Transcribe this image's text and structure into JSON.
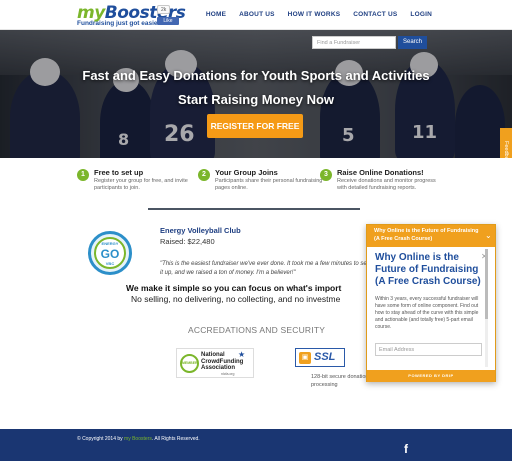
{
  "header": {
    "logo_my": "my",
    "logo_boosters": "Boosters",
    "tagline": "Fundraising just got easier.",
    "fb_count": "2k",
    "fb_like": "Like",
    "nav": [
      "HOME",
      "ABOUT US",
      "HOW IT WORKS",
      "CONTACT US",
      "LOGIN"
    ]
  },
  "hero": {
    "search_placeholder": "Find a Fundraiser",
    "search_button": "Search",
    "title": "Fast and Easy Donations for Youth Sports and Activities",
    "subtitle": "Start Raising Money Now",
    "register_button": "REGISTER FOR FREE",
    "feedback_tab": "Feedback",
    "jersey_numbers": [
      "26",
      "8",
      "5",
      "11"
    ]
  },
  "steps": [
    {
      "num": "1",
      "title": "Free to set up",
      "desc": "Register your group for free, and invite participants to join."
    },
    {
      "num": "2",
      "title": "Your Group Joins",
      "desc": "Participants share their personal fundraising pages online."
    },
    {
      "num": "3",
      "title": "Raise Online Donations!",
      "desc": "Receive donations and monitor progress with detailed fundraising reports."
    }
  ],
  "testimonial": {
    "logo_top": "ENERGY",
    "logo_mid": "GO",
    "logo_bot": "VBC",
    "club_name": "Energy Volleyball Club",
    "raised": "Raised: $22,480",
    "quote": "\"This is the easiest fundraiser we've ever done. It took me a few minutes to set it up, and we raised a ton of money. I'm a believer!\""
  },
  "simple": {
    "heading": "We make it simple so you can focus on what's import",
    "sub": "No selling, no delivering, no collecting, and no investme"
  },
  "accreditations": {
    "heading": "ACCREDATIONS AND SECURITY",
    "ncfa_lines": "National CrowdFunding Association",
    "ncfa_member": "MEMBER",
    "ncfa_site": "nlcfa.org",
    "ssl_label": "SSL",
    "ssl_caption": "128-bit secure donation processing"
  },
  "popup": {
    "bar_title": "Why Online is the Future of Fundraising (A Free Crash Course)",
    "title": "Why Online is the Future of Fundraising (A Free Crash Course)",
    "text": "Within 3 years, every successful fundraiser will have some form of online component. Find out how to stay ahead of the curve with this simple and actionable (and totally free) 5-part email course.",
    "email_placeholder": "Email Address",
    "footer": "POWERED BY DRIP"
  },
  "footer": {
    "copyright_prefix": "© Copyright 2014 by ",
    "copyright_brand": "my Boosters",
    "copyright_suffix": ". All Rights Reserved.",
    "fb_icon": "f"
  },
  "colors": {
    "brand_green": "#7bb62b",
    "brand_blue": "#1f4e9c",
    "accent_orange": "#f59a16",
    "footer_navy": "#1a3672"
  }
}
